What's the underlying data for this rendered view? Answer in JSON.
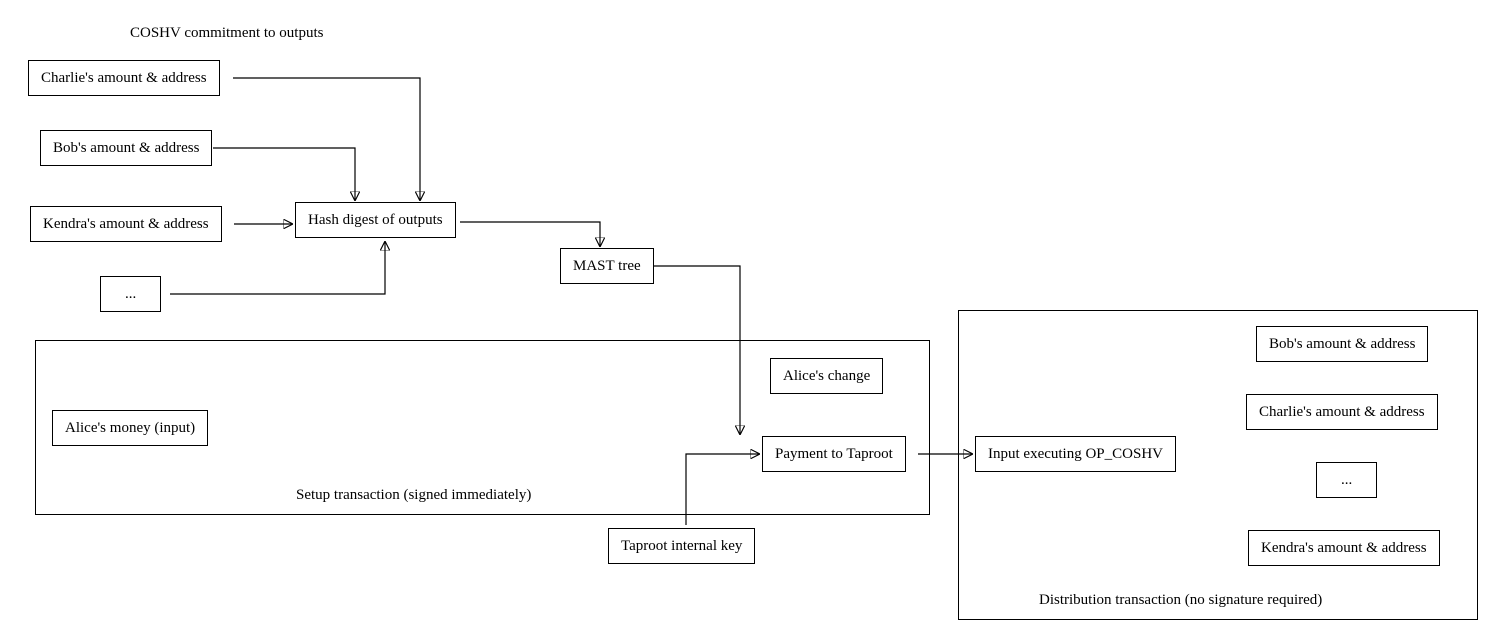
{
  "title_top": "COSHV commitment to outputs",
  "nodes": {
    "charlie": "Charlie's amount & address",
    "bob": "Bob's amount & address",
    "kendra": "Kendra's amount & address",
    "ellipsis": "...",
    "hash": "Hash digest of outputs",
    "mast": "MAST tree",
    "taprootkey": "Taproot internal key",
    "alice_change": "Alice's change",
    "payment": "Payment to Taproot",
    "alice_money": "Alice's money (input)",
    "input_exec": "Input executing OP_COSHV",
    "d_bob": "Bob's amount & address",
    "d_charlie": "Charlie's amount & address",
    "d_ellipsis": "...",
    "d_kendra": "Kendra's amount & address"
  },
  "clusters": {
    "setup": "Setup transaction (signed immediately)",
    "dist": "Distribution transaction (no signature required)"
  }
}
